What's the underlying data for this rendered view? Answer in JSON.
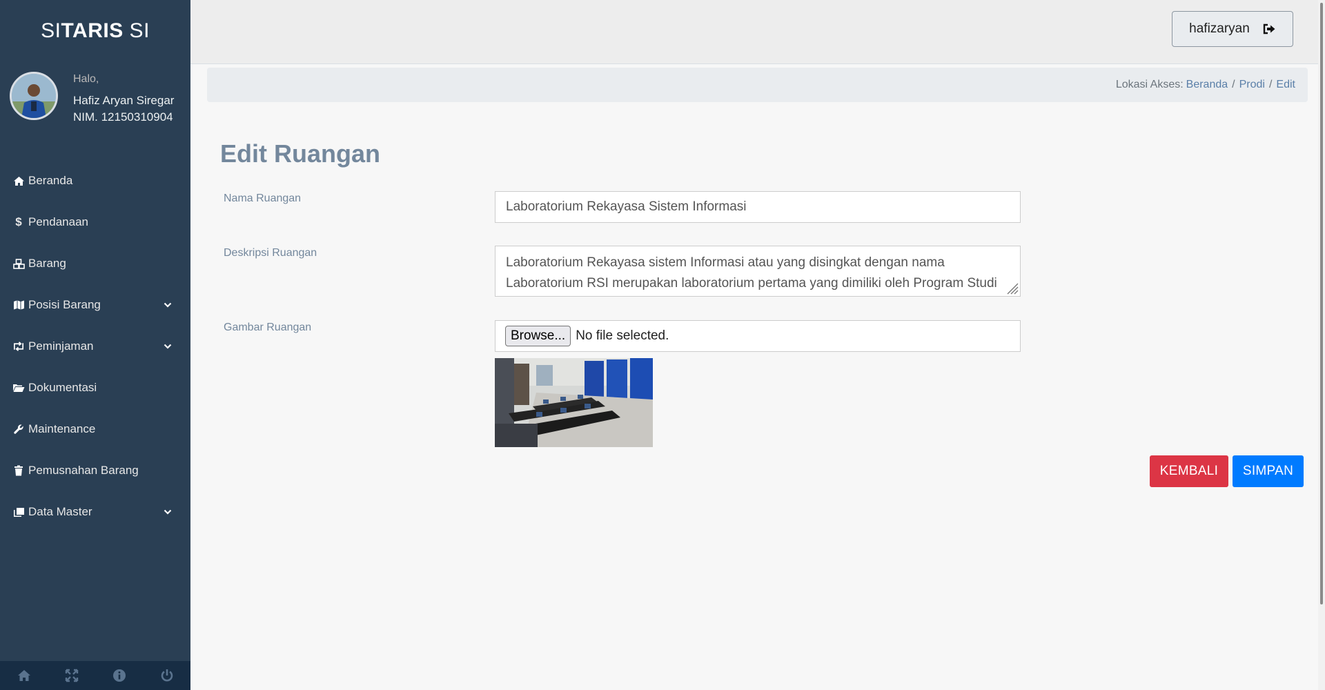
{
  "brand": {
    "prefix": "SI",
    "bold": "TARIS",
    "suffix": " SI"
  },
  "profile": {
    "greeting": "Halo,",
    "name": "Hafiz Aryan Siregar",
    "nim": "NIM. 12150310904"
  },
  "menu": [
    {
      "label": "Beranda",
      "icon": "home-icon"
    },
    {
      "label": "Pendanaan",
      "icon": "dollar-icon"
    },
    {
      "label": "Barang",
      "icon": "cubes-icon"
    },
    {
      "label": "Posisi Barang",
      "icon": "map-icon",
      "has_submenu": true
    },
    {
      "label": "Peminjaman",
      "icon": "retweet-icon",
      "has_submenu": true
    },
    {
      "label": "Dokumentasi",
      "icon": "folder-open-icon"
    },
    {
      "label": "Maintenance",
      "icon": "wrench-icon"
    },
    {
      "label": "Pemusnahan Barang",
      "icon": "trash-icon"
    },
    {
      "label": "Data Master",
      "icon": "clone-icon",
      "has_submenu": true
    }
  ],
  "footer_icons": [
    "home-icon",
    "fullscreen-icon",
    "info-icon",
    "power-icon"
  ],
  "topnav": {
    "username": "hafizaryan",
    "logout_icon": "sign-out-icon"
  },
  "breadcrumb": {
    "prefix": "Lokasi Akses:",
    "items": [
      "Beranda",
      "Prodi",
      "Edit"
    ]
  },
  "page": {
    "title": "Edit Ruangan"
  },
  "form": {
    "nama_label": "Nama Ruangan",
    "nama_value": "Laboratorium Rekayasa Sistem Informasi",
    "deskripsi_label": "Deskripsi Ruangan",
    "deskripsi_value": "Laboratorium Rekayasa sistem Informasi atau yang disingkat dengan nama Laboratorium RSI merupakan laboratorium pertama yang dimiliki oleh Program Studi",
    "gambar_label": "Gambar Ruangan",
    "browse_label": "Browse...",
    "file_status": "No file selected."
  },
  "buttons": {
    "back": "KEMBALI",
    "save": "SIMPAN"
  },
  "colors": {
    "sidebar": "#2a3f54",
    "danger": "#dc3545",
    "primary": "#007bff",
    "title": "#73879c"
  }
}
